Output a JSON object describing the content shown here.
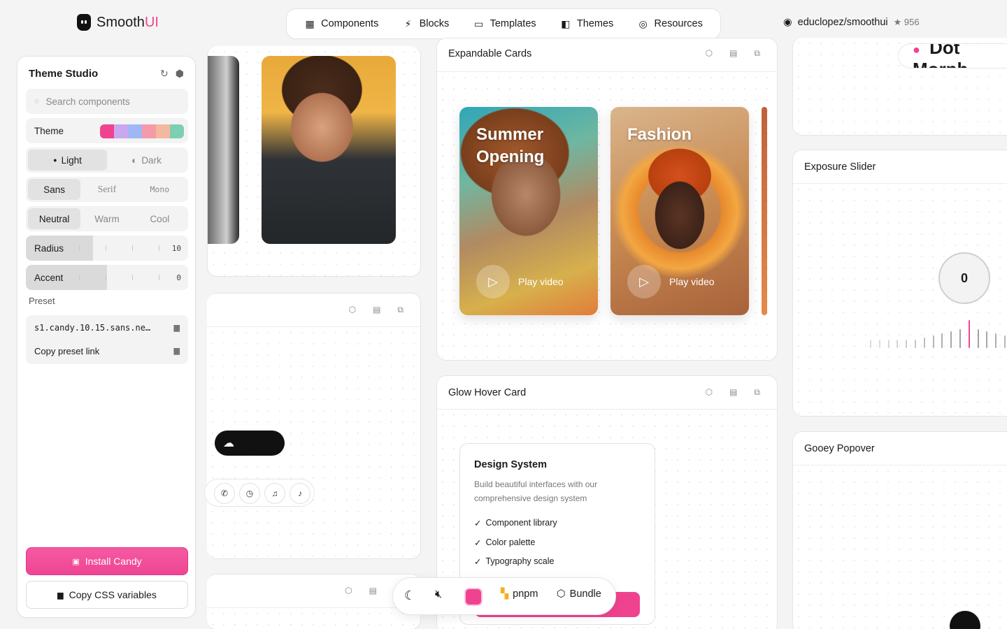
{
  "brand": {
    "name_main": "Smooth",
    "name_accent": "UI",
    "accent": "#f0438f"
  },
  "nav": [
    {
      "label": "Components",
      "icon": "grid-icon"
    },
    {
      "label": "Blocks",
      "icon": "bolt-icon"
    },
    {
      "label": "Templates",
      "icon": "window-icon"
    },
    {
      "label": "Themes",
      "icon": "palette-icon"
    },
    {
      "label": "Resources",
      "icon": "circle-icon"
    }
  ],
  "github": {
    "repo": "educlopez/smoothui",
    "stars": "956"
  },
  "studio": {
    "title": "Theme Studio",
    "search_placeholder": "Search components",
    "theme_label": "Theme",
    "swatches": [
      "#f0438f",
      "#c9a8f0",
      "#9fb8f5",
      "#f59aa8",
      "#f3b9a0",
      "#7ccfb0"
    ],
    "mode": [
      "Light",
      "Dark"
    ],
    "fonts": [
      "Sans",
      "Serif",
      "Mono"
    ],
    "tones": [
      "Neutral",
      "Warm",
      "Cool"
    ],
    "radius": {
      "label": "Radius",
      "value": "10"
    },
    "accent": {
      "label": "Accent",
      "value": "0"
    },
    "preset_label": "Preset",
    "preset_code": "s1.candy.10.15.sans.ne…",
    "copy_preset": "Copy preset link",
    "install": "Install Candy",
    "copy_css": "Copy CSS variables"
  },
  "cards": {
    "expandable": {
      "title": "Expandable Cards",
      "play": "Play video",
      "items": [
        "Summer Opening",
        "Fashion"
      ]
    },
    "exposure": {
      "title": "Exposure Slider",
      "value": "0"
    },
    "glow": {
      "title": "Glow Hover Card",
      "inner_title": "Design System",
      "desc": "Build beautiful interfaces with our comprehensive design system",
      "items": [
        "Component library",
        "Color palette",
        "Typography scale"
      ]
    },
    "gooey": {
      "title": "Gooey Popover"
    },
    "dot": {
      "title": "Dot Morph"
    }
  },
  "dock": {
    "pm": "pnpm",
    "bundle": "Bundle"
  }
}
